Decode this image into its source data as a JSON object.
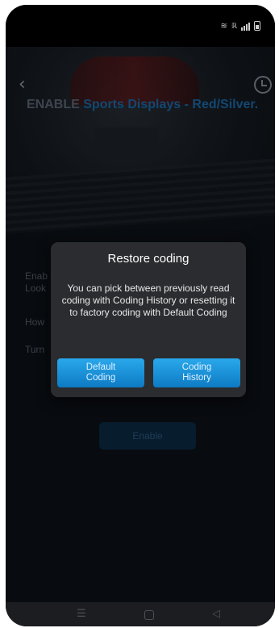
{
  "app": {
    "title_prefix": "ENABLE",
    "title_feature": "Sports Displays - Red/Silver.",
    "descriptions": [
      "Enab\nLook",
      "How",
      "Turn"
    ],
    "enable_label": "Enable"
  },
  "dialog": {
    "title": "Restore coding",
    "message": "You can pick between previously read coding with Coding History or resetting it to factory coding with Default Coding",
    "default_line1": "Default",
    "default_line2": "Coding",
    "history_line1": "Coding",
    "history_line2": "History"
  },
  "icons": {
    "back": "back-chevron-icon",
    "history": "history-clock-icon",
    "wifi": "wifi-icon",
    "signal": "signal-bars-icon",
    "battery": "battery-icon",
    "nav_menu": "menu-icon",
    "nav_home": "home-icon",
    "nav_back": "back-triangle-icon"
  },
  "status": {
    "network": "ℝ"
  },
  "colors": {
    "accent": "#1c8fd6",
    "dialog_bg": "#2a2c2f",
    "title_feature": "#1c6fb0"
  }
}
